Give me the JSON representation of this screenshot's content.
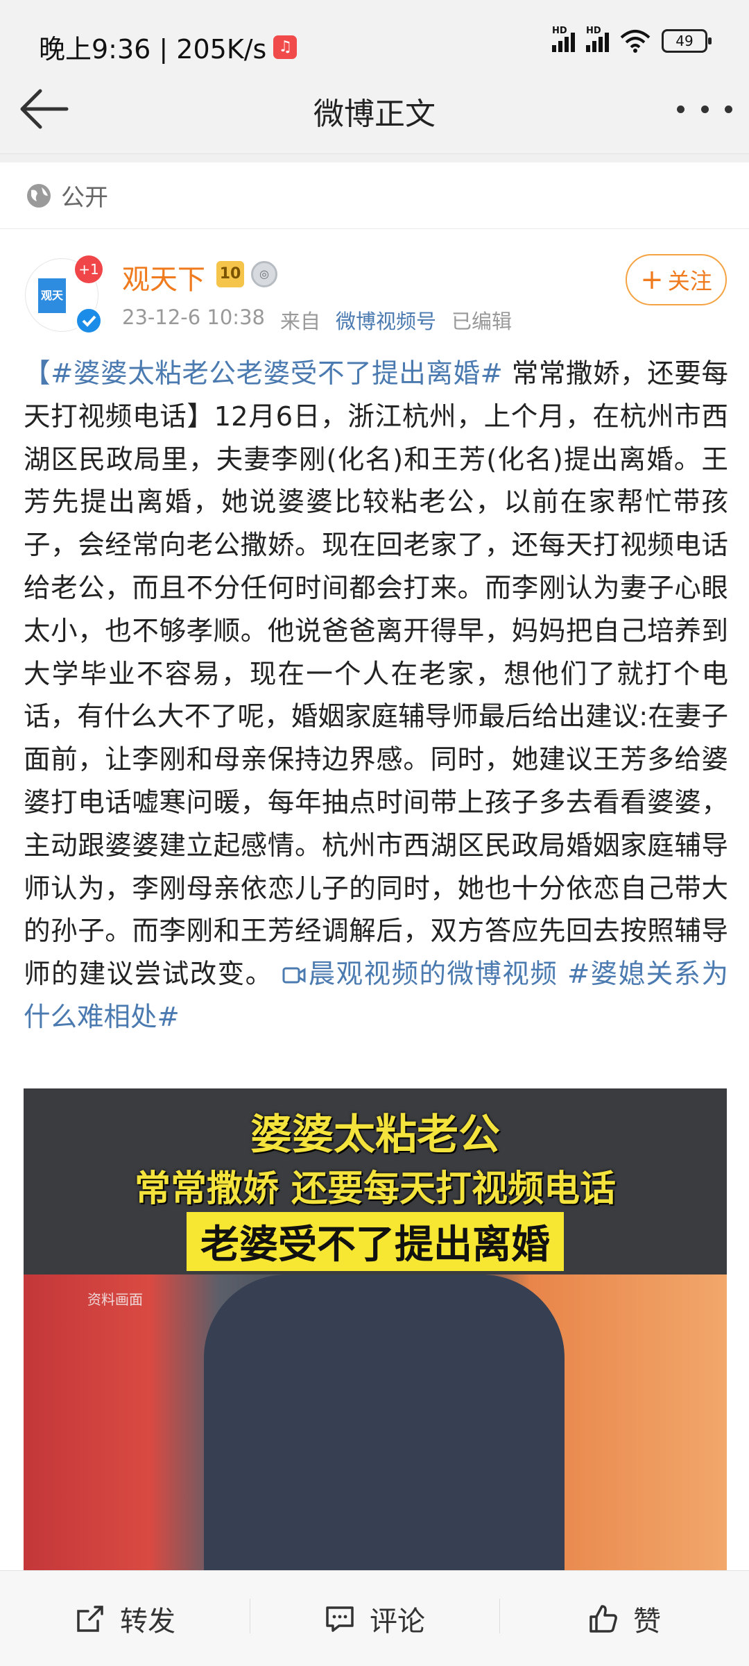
{
  "status_bar": {
    "time_label": "晚上9:36 | 205K/s",
    "battery": "49"
  },
  "header": {
    "title": "微博正文"
  },
  "visibility": {
    "label": "公开",
    "icon": "globe-icon"
  },
  "author": {
    "name": "观天下",
    "badge_count": "+1",
    "rank_badge": "10",
    "avatar_text": "观天下",
    "date": "23-12-6 10:38",
    "source_prefix": "来自",
    "source": "微博视频号",
    "edited": "已编辑",
    "follow_label": "关注"
  },
  "post": {
    "hashtag1": "【#婆婆太粘老公老婆受不了提出离婚#",
    "text": " 常常撒娇，还要每天打视频电话】12月6日，浙江杭州，上个月，在杭州市西湖区民政局里，夫妻李刚(化名)和王芳(化名)提出离婚。王芳先提出离婚，她说婆婆比较粘老公，以前在家帮忙带孩子，会经常向老公撒娇。现在回老家了，还每天打视频电话给老公，而且不分任何时间都会打来。而李刚认为妻子心眼太小，也不够孝顺。他说爸爸离开得早，妈妈把自己培养到大学毕业不容易，现在一个人在老家，想他们了就打个电话，有什么大不了呢，婚姻家庭辅导师最后给出建议:在妻子面前，让李刚和母亲保持边界感。同时，她建议王芳多给婆婆打电话嘘寒问暖，每年抽点时间带上孩子多去看看婆婆，主动跟婆婆建立起感情。杭州市西湖区民政局婚姻家庭辅导师认为，李刚母亲依恋儿子的同时，她也十分依恋自己带大的孙子。而李刚和王芳经调解后，双方答应先回去按照辅导师的建议尝试改变。 ",
    "video_link": "晨观视频的微博视频",
    "hashtag2": " #婆媳关系为什么难相处#"
  },
  "video": {
    "caption1": "婆婆太粘老公",
    "caption2": "常常撒娇 还要每天打视频电话",
    "caption3": "老婆受不了提出离婚",
    "tag": "资料画面"
  },
  "actions": {
    "repost": "转发",
    "comment": "评论",
    "like": "赞"
  },
  "colors": {
    "accent_orange": "#f07b1f",
    "link_blue": "#4a7ab0"
  }
}
